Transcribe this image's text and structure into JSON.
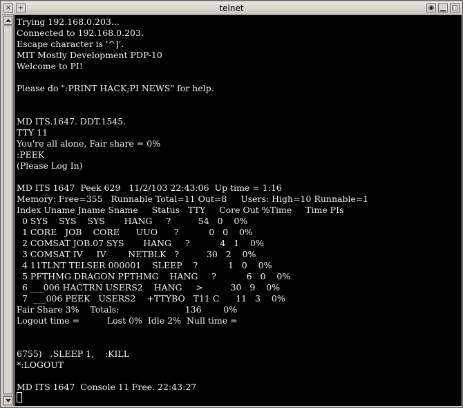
{
  "window": {
    "title": "telnet",
    "close_glyph": "×",
    "plus_glyph": "+",
    "eye_glyph": "◉",
    "minimize_glyph": "▁",
    "maximize_glyph": "□"
  },
  "colors": {
    "background": "#000000",
    "foreground": "#f2f2f2",
    "titlebar": "#d4d0c8"
  },
  "terminal": {
    "lines": [
      "Trying 192.168.0.203...",
      "Connected to 192.168.0.203.",
      "Escape character is '^]'.",
      "MIT Mostly Development PDP-10",
      "Welcome to PI!",
      "",
      "Please do \":PRINT HACK;PI NEWS\" for help.",
      "",
      "",
      "MD ITS.1647. DDT.1545.",
      "TTY 11",
      "You're all alone, Fair share = 0%",
      ":PEEK",
      "(Please Log In)",
      "",
      "MD ITS 1647  Peek 629   11/2/103 22:43:06  Up time = 1:16",
      "Memory: Free=355   Runnable Total=11 Out=8     Users: High=10 Runnable=1",
      "Index Uname Jname Sname     Status   TTY     Core Out %Time     Time PIs",
      "  0 SYS    SYS    SYS       HANG     ?          54   0    0%",
      "  1 CORE   JOB    CORE      UUO      ?           0   0    0%",
      "  2 COMSAT JOB.07 SYS       HANG     ?           4   1    0%",
      "  3 COMSAT IV     IV        NETBLK   ?          30   2    0%",
      "  4 11TLNT TELSER 000001    SLEEP    ?           1   0    0%",
      "  5 PFTHMG DRAGON PFTHMG    HANG     ?           6   0    0%",
      "  6 ___006 HACTRN USERS2    HANG     >          30   9    0%",
      "  7  ___006 PEEK   USERS2    +TTYBO   T11 C      11   3    0%",
      "Fair Share 3%    Totals:                        136        0%",
      "Logout time =          Lost 0%  Idle 2%  Null time =",
      "",
      "",
      "6755)   .SLEEP 1,    :KILL",
      "*:LOGOUT",
      "",
      "MD ITS 1647  Console 11 Free. 22:43:27"
    ]
  }
}
